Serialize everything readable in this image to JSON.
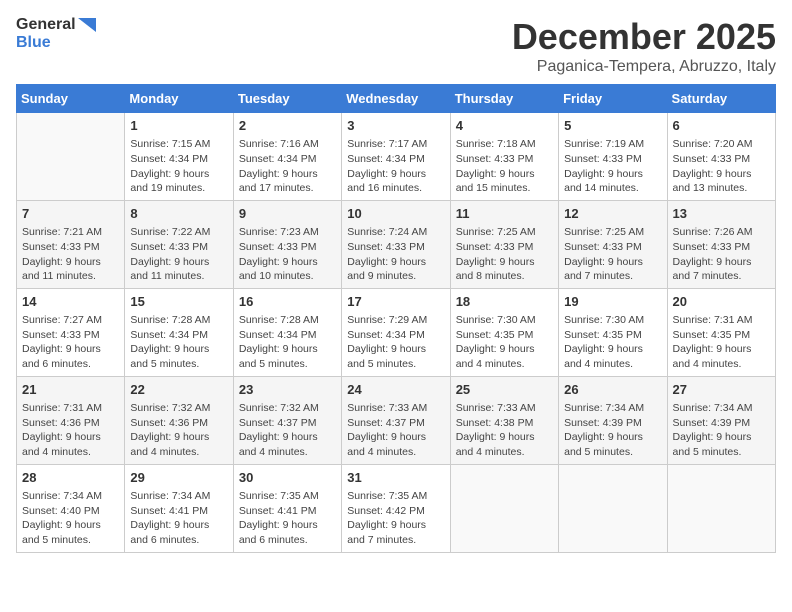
{
  "logo": {
    "general": "General",
    "blue": "Blue"
  },
  "title": "December 2025",
  "location": "Paganica-Tempera, Abruzzo, Italy",
  "weekdays": [
    "Sunday",
    "Monday",
    "Tuesday",
    "Wednesday",
    "Thursday",
    "Friday",
    "Saturday"
  ],
  "weeks": [
    [
      {
        "day": "",
        "sunrise": "",
        "sunset": "",
        "daylight": ""
      },
      {
        "day": "1",
        "sunrise": "Sunrise: 7:15 AM",
        "sunset": "Sunset: 4:34 PM",
        "daylight": "Daylight: 9 hours and 19 minutes."
      },
      {
        "day": "2",
        "sunrise": "Sunrise: 7:16 AM",
        "sunset": "Sunset: 4:34 PM",
        "daylight": "Daylight: 9 hours and 17 minutes."
      },
      {
        "day": "3",
        "sunrise": "Sunrise: 7:17 AM",
        "sunset": "Sunset: 4:34 PM",
        "daylight": "Daylight: 9 hours and 16 minutes."
      },
      {
        "day": "4",
        "sunrise": "Sunrise: 7:18 AM",
        "sunset": "Sunset: 4:33 PM",
        "daylight": "Daylight: 9 hours and 15 minutes."
      },
      {
        "day": "5",
        "sunrise": "Sunrise: 7:19 AM",
        "sunset": "Sunset: 4:33 PM",
        "daylight": "Daylight: 9 hours and 14 minutes."
      },
      {
        "day": "6",
        "sunrise": "Sunrise: 7:20 AM",
        "sunset": "Sunset: 4:33 PM",
        "daylight": "Daylight: 9 hours and 13 minutes."
      }
    ],
    [
      {
        "day": "7",
        "sunrise": "Sunrise: 7:21 AM",
        "sunset": "Sunset: 4:33 PM",
        "daylight": "Daylight: 9 hours and 11 minutes."
      },
      {
        "day": "8",
        "sunrise": "Sunrise: 7:22 AM",
        "sunset": "Sunset: 4:33 PM",
        "daylight": "Daylight: 9 hours and 11 minutes."
      },
      {
        "day": "9",
        "sunrise": "Sunrise: 7:23 AM",
        "sunset": "Sunset: 4:33 PM",
        "daylight": "Daylight: 9 hours and 10 minutes."
      },
      {
        "day": "10",
        "sunrise": "Sunrise: 7:24 AM",
        "sunset": "Sunset: 4:33 PM",
        "daylight": "Daylight: 9 hours and 9 minutes."
      },
      {
        "day": "11",
        "sunrise": "Sunrise: 7:25 AM",
        "sunset": "Sunset: 4:33 PM",
        "daylight": "Daylight: 9 hours and 8 minutes."
      },
      {
        "day": "12",
        "sunrise": "Sunrise: 7:25 AM",
        "sunset": "Sunset: 4:33 PM",
        "daylight": "Daylight: 9 hours and 7 minutes."
      },
      {
        "day": "13",
        "sunrise": "Sunrise: 7:26 AM",
        "sunset": "Sunset: 4:33 PM",
        "daylight": "Daylight: 9 hours and 7 minutes."
      }
    ],
    [
      {
        "day": "14",
        "sunrise": "Sunrise: 7:27 AM",
        "sunset": "Sunset: 4:33 PM",
        "daylight": "Daylight: 9 hours and 6 minutes."
      },
      {
        "day": "15",
        "sunrise": "Sunrise: 7:28 AM",
        "sunset": "Sunset: 4:34 PM",
        "daylight": "Daylight: 9 hours and 5 minutes."
      },
      {
        "day": "16",
        "sunrise": "Sunrise: 7:28 AM",
        "sunset": "Sunset: 4:34 PM",
        "daylight": "Daylight: 9 hours and 5 minutes."
      },
      {
        "day": "17",
        "sunrise": "Sunrise: 7:29 AM",
        "sunset": "Sunset: 4:34 PM",
        "daylight": "Daylight: 9 hours and 5 minutes."
      },
      {
        "day": "18",
        "sunrise": "Sunrise: 7:30 AM",
        "sunset": "Sunset: 4:35 PM",
        "daylight": "Daylight: 9 hours and 4 minutes."
      },
      {
        "day": "19",
        "sunrise": "Sunrise: 7:30 AM",
        "sunset": "Sunset: 4:35 PM",
        "daylight": "Daylight: 9 hours and 4 minutes."
      },
      {
        "day": "20",
        "sunrise": "Sunrise: 7:31 AM",
        "sunset": "Sunset: 4:35 PM",
        "daylight": "Daylight: 9 hours and 4 minutes."
      }
    ],
    [
      {
        "day": "21",
        "sunrise": "Sunrise: 7:31 AM",
        "sunset": "Sunset: 4:36 PM",
        "daylight": "Daylight: 9 hours and 4 minutes."
      },
      {
        "day": "22",
        "sunrise": "Sunrise: 7:32 AM",
        "sunset": "Sunset: 4:36 PM",
        "daylight": "Daylight: 9 hours and 4 minutes."
      },
      {
        "day": "23",
        "sunrise": "Sunrise: 7:32 AM",
        "sunset": "Sunset: 4:37 PM",
        "daylight": "Daylight: 9 hours and 4 minutes."
      },
      {
        "day": "24",
        "sunrise": "Sunrise: 7:33 AM",
        "sunset": "Sunset: 4:37 PM",
        "daylight": "Daylight: 9 hours and 4 minutes."
      },
      {
        "day": "25",
        "sunrise": "Sunrise: 7:33 AM",
        "sunset": "Sunset: 4:38 PM",
        "daylight": "Daylight: 9 hours and 4 minutes."
      },
      {
        "day": "26",
        "sunrise": "Sunrise: 7:34 AM",
        "sunset": "Sunset: 4:39 PM",
        "daylight": "Daylight: 9 hours and 5 minutes."
      },
      {
        "day": "27",
        "sunrise": "Sunrise: 7:34 AM",
        "sunset": "Sunset: 4:39 PM",
        "daylight": "Daylight: 9 hours and 5 minutes."
      }
    ],
    [
      {
        "day": "28",
        "sunrise": "Sunrise: 7:34 AM",
        "sunset": "Sunset: 4:40 PM",
        "daylight": "Daylight: 9 hours and 5 minutes."
      },
      {
        "day": "29",
        "sunrise": "Sunrise: 7:34 AM",
        "sunset": "Sunset: 4:41 PM",
        "daylight": "Daylight: 9 hours and 6 minutes."
      },
      {
        "day": "30",
        "sunrise": "Sunrise: 7:35 AM",
        "sunset": "Sunset: 4:41 PM",
        "daylight": "Daylight: 9 hours and 6 minutes."
      },
      {
        "day": "31",
        "sunrise": "Sunrise: 7:35 AM",
        "sunset": "Sunset: 4:42 PM",
        "daylight": "Daylight: 9 hours and 7 minutes."
      },
      {
        "day": "",
        "sunrise": "",
        "sunset": "",
        "daylight": ""
      },
      {
        "day": "",
        "sunrise": "",
        "sunset": "",
        "daylight": ""
      },
      {
        "day": "",
        "sunrise": "",
        "sunset": "",
        "daylight": ""
      }
    ]
  ]
}
